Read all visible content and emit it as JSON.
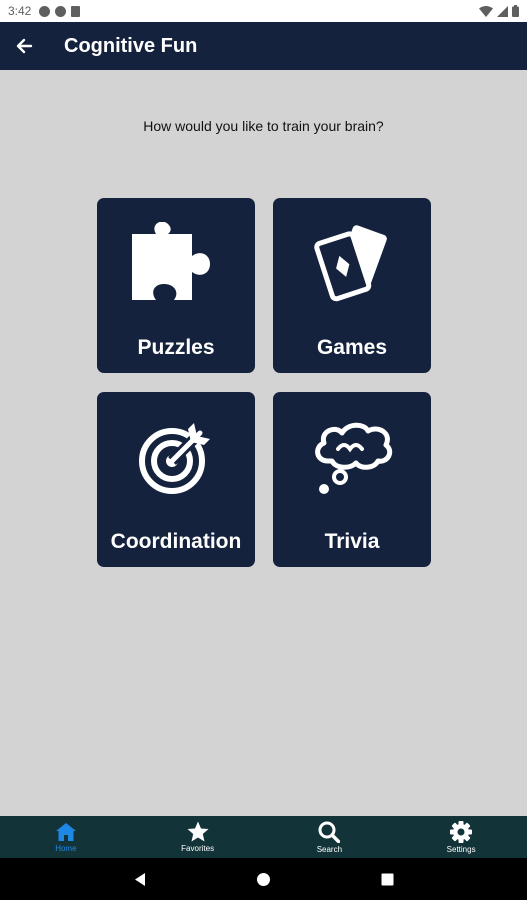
{
  "status_bar": {
    "time": "3:42"
  },
  "app_bar": {
    "title": "Cognitive Fun"
  },
  "prompt": "How would you like to train your brain?",
  "tiles": [
    {
      "label": "Puzzles",
      "icon": "puzzle-piece-icon"
    },
    {
      "label": "Games",
      "icon": "playing-cards-icon"
    },
    {
      "label": "Coordination",
      "icon": "target-icon"
    },
    {
      "label": "Trivia",
      "icon": "thought-bubble-icon"
    }
  ],
  "bottom_nav": {
    "items": [
      {
        "label": "Home",
        "icon": "home-icon",
        "active": true
      },
      {
        "label": "Favorites",
        "icon": "star-icon",
        "active": false
      },
      {
        "label": "Search",
        "icon": "search-icon",
        "active": false
      },
      {
        "label": "Settings",
        "icon": "gear-icon",
        "active": false
      }
    ]
  },
  "colors": {
    "background": "#d3d3d3",
    "primary": "#14223d",
    "bottom_nav": "#123438",
    "active_nav": "#1e88e5"
  }
}
